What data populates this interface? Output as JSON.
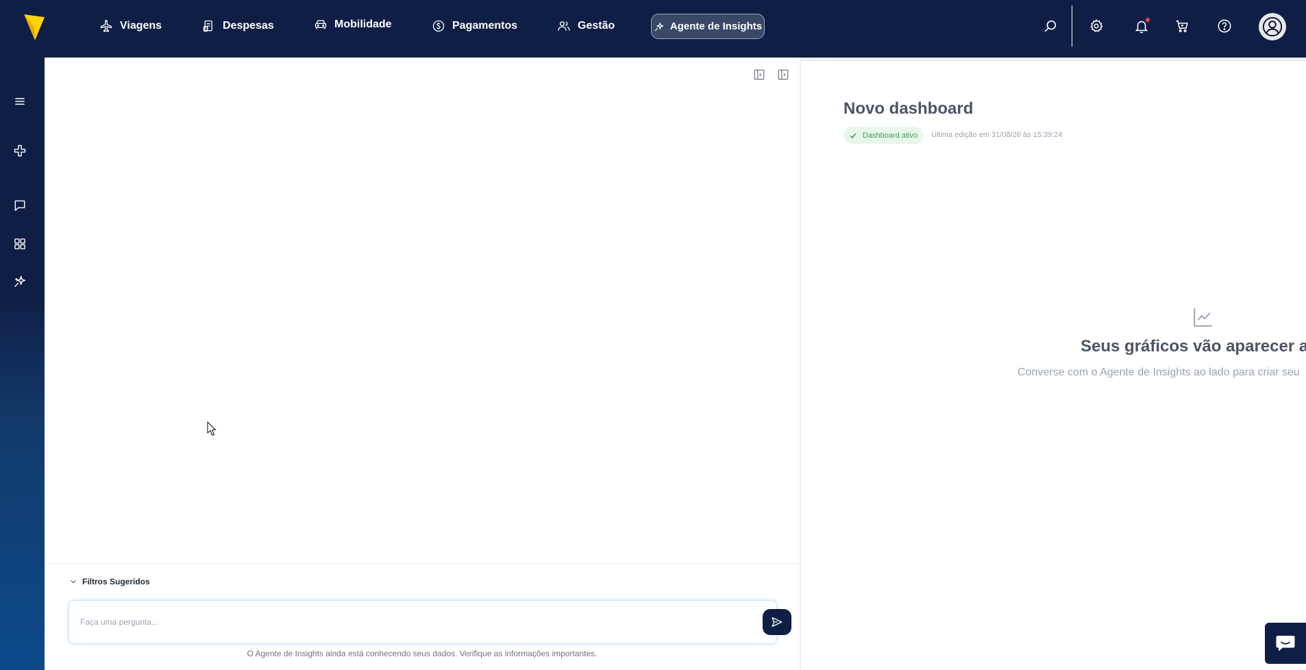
{
  "colors": {
    "navy": "#0f1e45",
    "accent": "#ffd400",
    "success": "#3f9a55"
  },
  "nav": {
    "items": [
      {
        "label": "Viagens",
        "icon": "airplane-icon"
      },
      {
        "label": "Despesas",
        "icon": "receipt-icon"
      },
      {
        "label": "Mobilidade",
        "icon": "car-icon"
      },
      {
        "label": "Pagamentos",
        "icon": "dollar-coin-icon"
      },
      {
        "label": "Gestão",
        "icon": "users-icon"
      }
    ],
    "active": {
      "label": "Agente de Insights",
      "icon": "sparkle-icon"
    },
    "actions": [
      "search-icon",
      "gear-icon",
      "bell-icon",
      "cart-icon",
      "help-icon",
      "avatar-icon"
    ]
  },
  "sidebar": {
    "icons": [
      "menu-icon",
      "plus-icon",
      "chat-icon",
      "dashboard-grid-icon",
      "sparkle-icon"
    ]
  },
  "chat": {
    "filters_label": "Filtros Sugeridos",
    "input_placeholder": "Faça uma pergunta...",
    "disclaimer": "O Agente de Insights ainda está conhecendo seus dados. Verifique as informações importantes."
  },
  "dashboard": {
    "title": "Novo dashboard",
    "status": "Dashboard ativo",
    "last_edit": "Última edição em 31/08/26 às 15:39:24",
    "empty_title": "Seus gráficos vão aparecer ac",
    "empty_subtitle": "Converse com o Agente de Insights ao lado para criar seu"
  }
}
